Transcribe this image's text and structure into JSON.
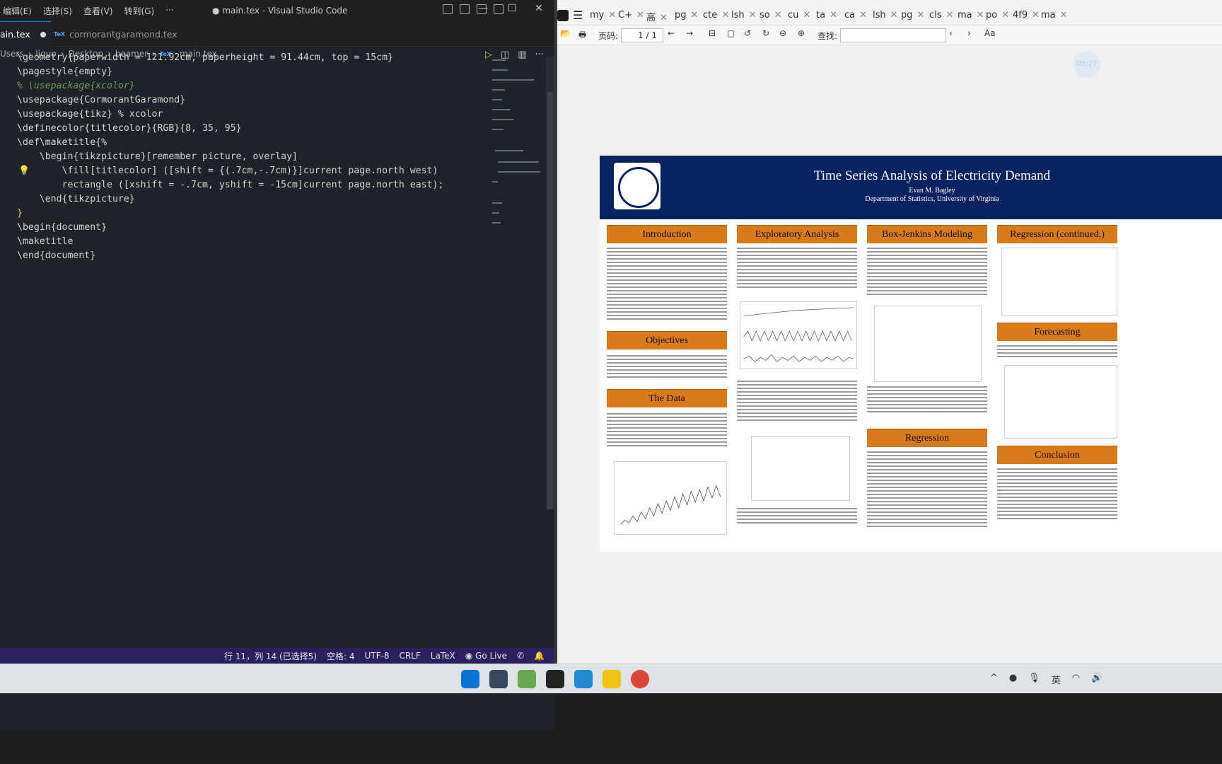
{
  "vscode": {
    "menu": [
      "编辑(E)",
      "选择(S)",
      "查看(V)",
      "转到(G)",
      "···"
    ],
    "window_title": "● main.tex - Visual Studio Code",
    "win_min": "—",
    "win_max": "☐",
    "win_close": "✕",
    "tab_active": "ain.tex",
    "tab_other": "cormorantgaramond.tex",
    "tex_badge": "TeX",
    "breadcrumb": [
      "Users",
      "ljguo",
      "Desktop",
      "beamer",
      "main.tex"
    ],
    "crumb_sep": "›",
    "code": [
      "\\geometry{paperwidth = 121.92cm, paperheight = 91.44cm, top = 15cm}",
      "\\pagestyle{empty}",
      "% \\usepackage{xcolor}",
      "\\usepackage{CormorantGaramond}",
      "\\usepackage{tikz} % xcolor",
      "\\definecolor{titlecolor}{RGB}{8, 35, 95}",
      "\\def\\maketitle{%",
      "    \\begin{tikzpicture}[remember picture, overlay]",
      "        \\fill[titlecolor] ([shift = {(.7cm,-.7cm)}]current page.north west)",
      "        rectangle ([xshift = -.7cm, yshift = -15cm]current page.north east);",
      "    \\end{tikzpicture}",
      "}",
      "\\begin{document}",
      "\\maketitle",
      "\\end{document}"
    ],
    "status": [
      "行 11，列 14 (已选择5)",
      "空格: 4",
      "UTF-8",
      "CRLF",
      "LaTeX",
      "Go Live"
    ],
    "bulb": "💡"
  },
  "pdf": {
    "tabs": [
      "my",
      "C+",
      "高",
      "pg",
      "cte",
      "lsh",
      "so",
      "cu",
      "ta",
      "ca",
      "lsh",
      "pg",
      "cls",
      "ma",
      "po",
      "4f9",
      "ma"
    ],
    "tab_close": "✕",
    "page_label": "页码:",
    "page_value": "1 / 1",
    "search_label": "查找:",
    "bubble": "05:27",
    "poster": {
      "title": "Time Series Analysis of Electricity Demand",
      "author": "Evan M. Bagley",
      "dept": "Department of Statistics, University of Virginia",
      "sections": [
        "Introduction",
        "Objectives",
        "The Data",
        "Exploratory Analysis",
        "Box-Jenkins Modeling",
        "Regression",
        "Regression (continued.)",
        "Forecasting",
        "Conclusion"
      ]
    }
  },
  "taskbar": {
    "tray": [
      "^",
      "英"
    ]
  }
}
